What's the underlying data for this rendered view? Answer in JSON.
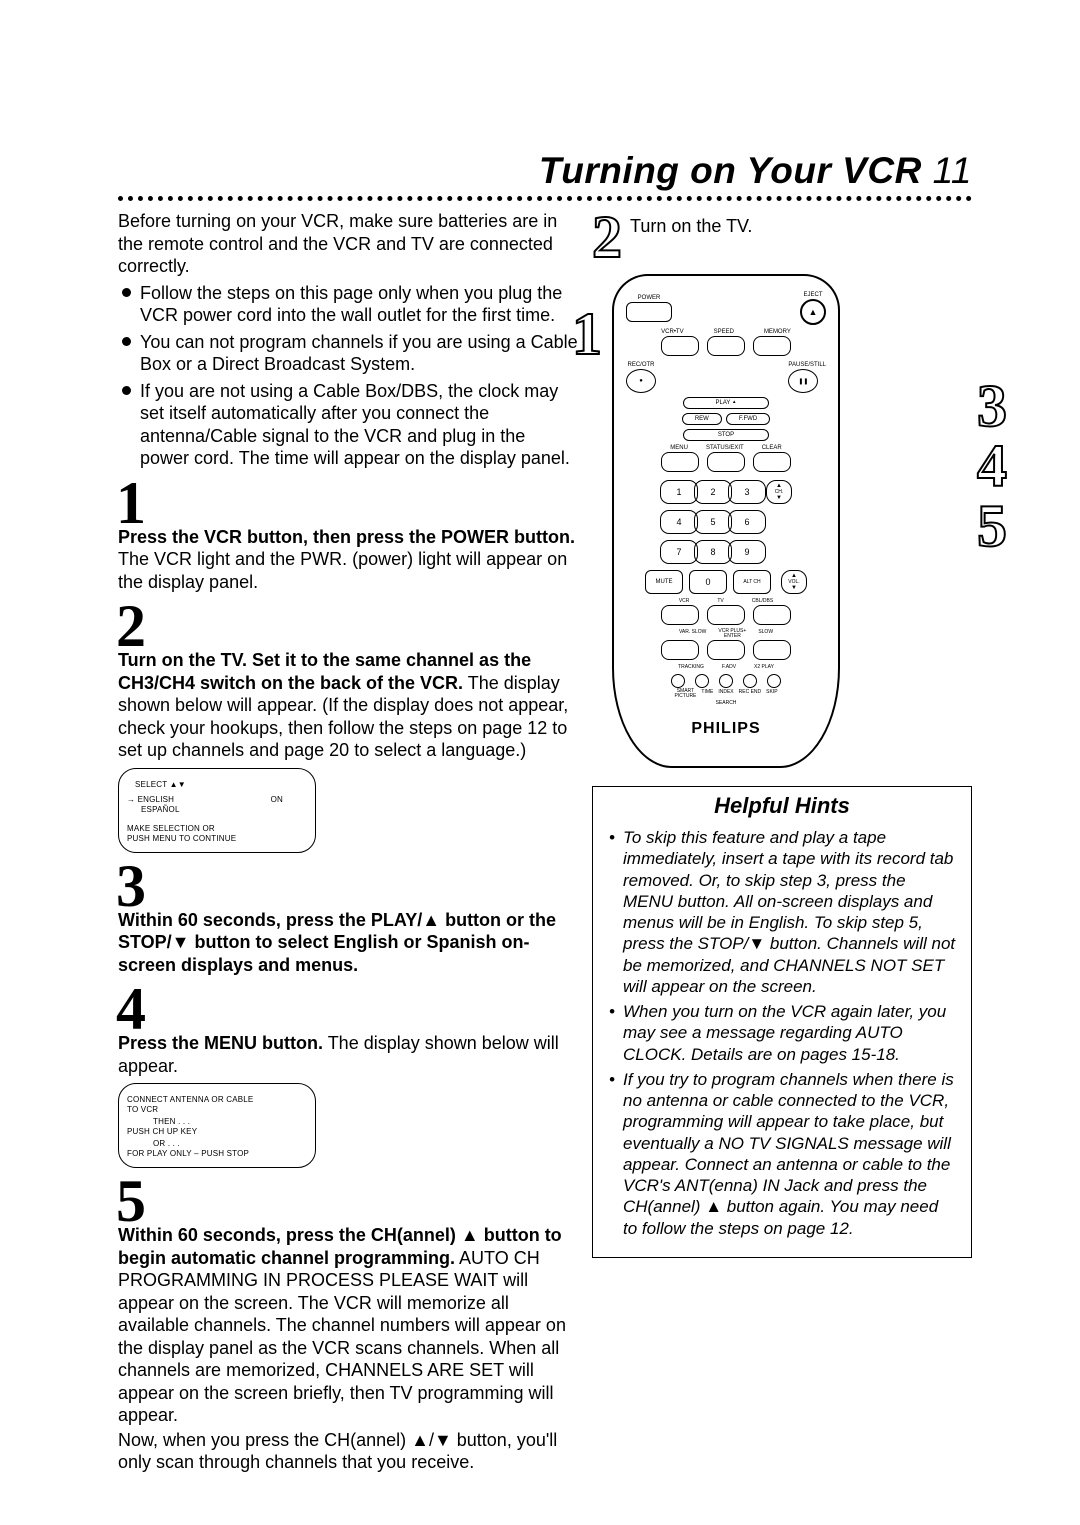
{
  "header": {
    "title_main": "Turning on Your VCR",
    "page_number": "11"
  },
  "overview": {
    "intro": "Before turning on your VCR, make sure batteries are in the remote control and the VCR and TV are connected correctly.",
    "bullets": [
      "Follow the steps on this page only when you plug the VCR power cord into the wall outlet for the first time.",
      "You can not program channels if you are using a Cable Box or a Direct Broadcast System.",
      "If you are not using a Cable Box/DBS, the clock may set itself automatically after you connect the antenna/Cable signal to the VCR and plug in the power cord. The time will appear on the display panel."
    ]
  },
  "steps": [
    {
      "num": "1",
      "bold": "Press the VCR button, then press the POWER button.",
      "rest": " The VCR light and the PWR. (power) light will appear on the display panel."
    },
    {
      "num": "2",
      "bold": "Turn on the TV. Set it to the same channel as the CH3/CH4 switch on the back of the VCR.",
      "rest": " The display shown below will appear. (If the display does not appear, check your hookups, then follow the steps on page 12 to set up channels and page 20 to select a language.)"
    },
    {
      "num": "3",
      "bold": "Within 60 seconds, press the PLAY/▲ button or the STOP/▼ button to select English or Spanish on-screen displays and menus.",
      "rest": ""
    },
    {
      "num": "4",
      "bold": "Press the MENU button.",
      "rest": " The display shown below will appear."
    },
    {
      "num": "5",
      "bold": "Within 60 seconds, press the CH(annel) ▲ button to begin automatic channel programming.",
      "rest": " AUTO CH PROGRAMMING IN PROCESS PLEASE WAIT will appear on the screen. The VCR will memorize all available channels.  The channel numbers will appear on the display panel as the VCR scans channels. When all channels are memorized, CHANNELS ARE SET will appear on the screen briefly, then TV programming will appear.",
      "extra": "Now, when you press the CH(annel) ▲/▼ button, you'll only scan through channels that you receive."
    }
  ],
  "osd1": {
    "l1": "SELECT ▲▼",
    "l2a": "→ ENGLISH",
    "l2b": "ON",
    "l3": "ESPAÑOL",
    "l4": "MAKE SELECTION OR",
    "l5": "PUSH MENU TO CONTINUE"
  },
  "osd2": {
    "l1": "CONNECT ANTENNA OR CABLE",
    "l2": "TO VCR",
    "l3": "THEN . . .",
    "l4": "PUSH CH UP KEY",
    "l5": "OR . . .",
    "l6": "FOR PLAY ONLY – PUSH STOP"
  },
  "right": {
    "step2_num": "2",
    "step2_text": "Turn on the TV.",
    "callouts": {
      "c1": "1",
      "c3": "3",
      "c4": "4",
      "c5": "5"
    }
  },
  "remote": {
    "power": "POWER",
    "eject": "EJECT",
    "vcrtv": "VCR•TV",
    "speed": "SPEED",
    "memory": "MEMORY",
    "recotr": "REC/OTR",
    "pausestill": "PAUSE/STILL",
    "play": "PLAY",
    "arrow_up": "▲",
    "rew": "REW",
    "ffwd": "F.FWD",
    "stop": "STOP",
    "menu": "MENU",
    "statusexit": "STATUS/EXIT",
    "clear": "CLEAR",
    "nums": [
      "1",
      "2",
      "3",
      "4",
      "5",
      "6",
      "7",
      "8",
      "9",
      "0"
    ],
    "ch": "CH.",
    "ch_up": "▲",
    "ch_dn": "▼",
    "mute": "MUTE",
    "altch": "ALT CH",
    "vcr": "VCR",
    "tv": "TV",
    "cbldbs": "CBL/DBS",
    "vol": "VOL.",
    "vol_up": "▲",
    "vol_dn": "▼",
    "varslow": "VAR. SLOW",
    "vcrplus": "VCR PLUS+",
    "enter": "ENTER",
    "slow": "SLOW",
    "tracking": "TRACKING",
    "fadv": "F.ADV",
    "x2play": "X2 PLAY",
    "smart": "SMART",
    "picture": "PICTURE",
    "time": "TIME",
    "index": "INDEX",
    "recend": "REC END",
    "skip": "SKIP",
    "search": "SEARCH",
    "brand": "PHILIPS"
  },
  "hints": {
    "heading": "Helpful Hints",
    "items": [
      "To skip this feature and play a tape immediately, insert a tape with its record tab removed. Or, to skip step 3, press the MENU button. All on-screen displays and menus will be in English. To skip step 5, press the STOP/▼ button.  Channels will not be memorized, and CHANNELS NOT SET will appear on the screen.",
      "When you turn on the VCR again later, you may see a message regarding AUTO CLOCK. Details are on pages 15-18.",
      "If you try to program channels when there is no antenna or cable connected to the VCR, programming will appear to take place, but eventually a NO TV SIGNALS message will appear. Connect an antenna or cable to the VCR's ANT(enna) IN Jack and press the CH(annel) ▲ button again. You may need to follow the steps on page 12."
    ]
  }
}
